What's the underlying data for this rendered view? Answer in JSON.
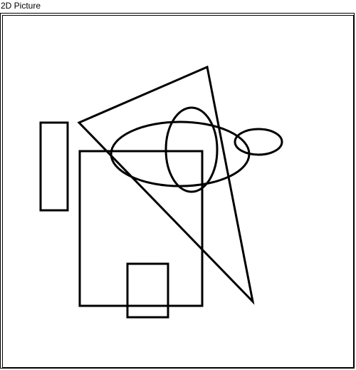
{
  "window": {
    "title": "2D Picture"
  },
  "canvas": {
    "stroke_color": "#000000",
    "background": "#ffffff",
    "shapes": [
      {
        "kind": "rectangle",
        "name": "tall-rectangle"
      },
      {
        "kind": "rectangle",
        "name": "large-square"
      },
      {
        "kind": "rectangle",
        "name": "small-rectangle"
      },
      {
        "kind": "triangle",
        "name": "triangle"
      },
      {
        "kind": "ellipse",
        "name": "wide-ellipse"
      },
      {
        "kind": "ellipse",
        "name": "tall-ellipse"
      },
      {
        "kind": "ellipse",
        "name": "small-ellipse"
      }
    ]
  }
}
